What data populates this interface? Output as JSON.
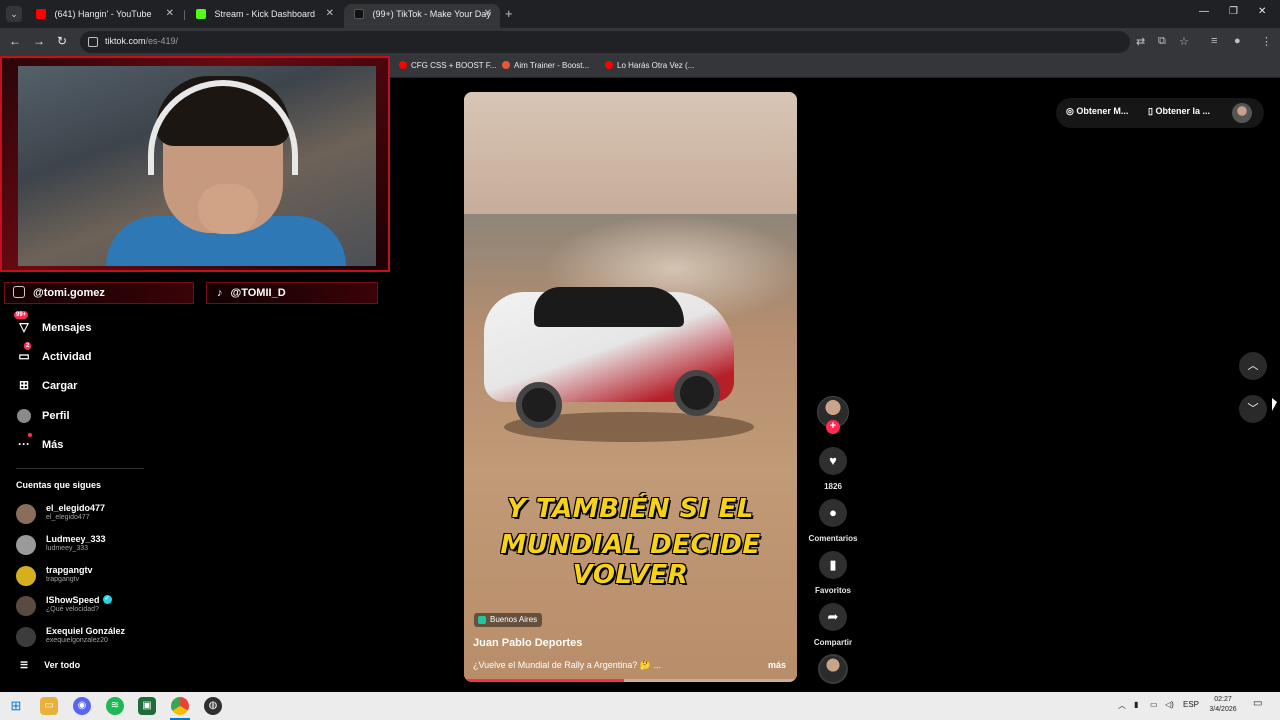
{
  "browser": {
    "tabs": [
      {
        "title": "(641) Hangin' - YouTube",
        "favicon_color": "#ff0000"
      },
      {
        "title": "Stream - Kick Dashboard",
        "favicon_color": "#53fc18"
      },
      {
        "title": "(99+) TikTok - Make Your Day",
        "favicon_color": "#111111"
      }
    ],
    "url_host": "tiktok.com",
    "url_path": "/es-419/",
    "bookmarks": [
      {
        "label": "CFG CSS + BOOST F...",
        "color": "#ff0000"
      },
      {
        "label": "Aim Trainer - Boost...",
        "color": "#e8563a"
      },
      {
        "label": "Lo Harás Otra Vez (...",
        "color": "#ff0000"
      }
    ]
  },
  "overlay": {
    "instagram_handle": "@tomi.gomez",
    "tiktok_handle": "@TOMII_D"
  },
  "sidebar": {
    "items": [
      {
        "label": "Mensajes",
        "icon": "send-icon",
        "badge": "99+"
      },
      {
        "label": "Actividad",
        "icon": "inbox-icon",
        "badge": "2"
      },
      {
        "label": "Cargar",
        "icon": "upload-icon"
      },
      {
        "label": "Perfil",
        "icon": "profile-icon"
      },
      {
        "label": "Más",
        "icon": "more-icon"
      }
    ],
    "following_title": "Cuentas que sigues",
    "following": [
      {
        "name": "el_elegido477",
        "handle": "el_elegido477",
        "avatar_color": "#8a6d5a"
      },
      {
        "name": "Ludmeey_333",
        "handle": "ludmeey_333",
        "avatar_color": "#9a9a9a"
      },
      {
        "name": "trapgangtv",
        "handle": "trapgangtv",
        "avatar_color": "#d4b11c"
      },
      {
        "name": "IShowSpeed",
        "handle": "¿Qué velocidad?",
        "avatar_color": "#5a4a42",
        "verified": true
      },
      {
        "name": "Exequiel González",
        "handle": "exequielgonzalez20",
        "avatar_color": "#3c3c3c"
      }
    ],
    "see_all": "Ver todo"
  },
  "video": {
    "caption_line1": "Y TAMBIÉN SI EL",
    "caption_line2": "MUNDIAL DECIDE VOLVER",
    "location": "Buenos Aires",
    "author": "Juan Pablo Deportes",
    "description": "¿Vuelve el Mundial de Rally a Argentina? 🤔 ...",
    "more": "más",
    "progress_fraction": 0.48
  },
  "actions": {
    "likes": "1826",
    "comments_label": "Comentarios",
    "favorites_label": "Favoritos",
    "share_label": "Compartir"
  },
  "header_right": {
    "coins_label": "Obtener M...",
    "app_label": "Obtener la ..."
  },
  "taskbar": {
    "language": "ESP",
    "time": "02:27",
    "date": "3/4/2026"
  }
}
